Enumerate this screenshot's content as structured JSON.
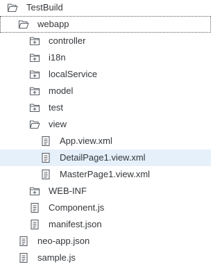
{
  "tree": {
    "items": [
      {
        "key": "testbuild",
        "label": "TestBuild",
        "level": 0,
        "icon": "folder-open-icon",
        "selected": false,
        "focused": false
      },
      {
        "key": "webapp",
        "label": "webapp",
        "level": 1,
        "icon": "folder-open-icon",
        "selected": false,
        "focused": true
      },
      {
        "key": "controller",
        "label": "controller",
        "level": 2,
        "icon": "folder-collapsed-icon",
        "selected": false,
        "focused": false
      },
      {
        "key": "i18n",
        "label": "i18n",
        "level": 2,
        "icon": "folder-collapsed-icon",
        "selected": false,
        "focused": false
      },
      {
        "key": "localservice",
        "label": "localService",
        "level": 2,
        "icon": "folder-collapsed-icon",
        "selected": false,
        "focused": false
      },
      {
        "key": "model",
        "label": "model",
        "level": 2,
        "icon": "folder-collapsed-icon",
        "selected": false,
        "focused": false
      },
      {
        "key": "test",
        "label": "test",
        "level": 2,
        "icon": "folder-collapsed-icon",
        "selected": false,
        "focused": false
      },
      {
        "key": "view",
        "label": "view",
        "level": 2,
        "icon": "folder-open-icon",
        "selected": false,
        "focused": false
      },
      {
        "key": "app-view-xml",
        "label": "App.view.xml",
        "level": 3,
        "icon": "document-icon",
        "selected": false,
        "focused": false
      },
      {
        "key": "detailpage1-view-xml",
        "label": "DetailPage1.view.xml",
        "level": 3,
        "icon": "document-icon",
        "selected": true,
        "focused": false
      },
      {
        "key": "masterpage1-view-xml",
        "label": "MasterPage1.view.xml",
        "level": 3,
        "icon": "document-icon",
        "selected": false,
        "focused": false
      },
      {
        "key": "web-inf",
        "label": "WEB-INF",
        "level": 2,
        "icon": "folder-collapsed-icon",
        "selected": false,
        "focused": false
      },
      {
        "key": "component-js",
        "label": "Component.js",
        "level": 2,
        "icon": "document-icon",
        "selected": false,
        "focused": false
      },
      {
        "key": "manifest-json",
        "label": "manifest.json",
        "level": 2,
        "icon": "document-icon",
        "selected": false,
        "focused": false
      },
      {
        "key": "neo-app-json",
        "label": "neo-app.json",
        "level": 1,
        "icon": "document-icon",
        "selected": false,
        "focused": false
      },
      {
        "key": "sample-js",
        "label": "sample.js",
        "level": 1,
        "icon": "document-icon",
        "selected": false,
        "focused": false
      }
    ]
  },
  "colors": {
    "text": "#32363a",
    "icon": "#5a5f66",
    "selected_row": "#e5f0fa"
  }
}
